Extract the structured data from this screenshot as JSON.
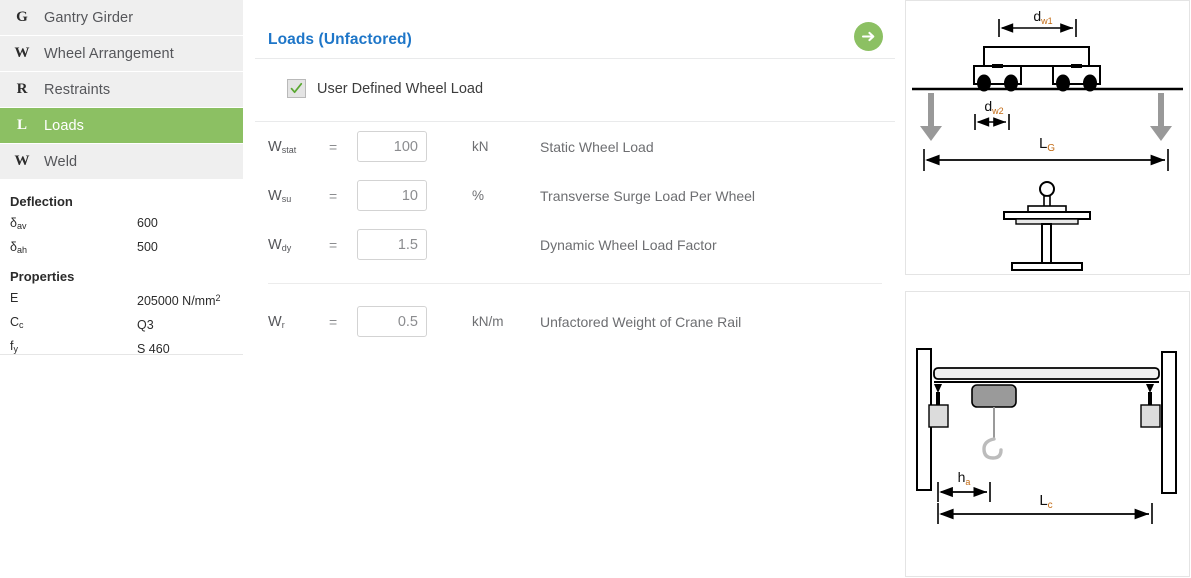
{
  "sidebar": {
    "items": [
      {
        "letter": "G",
        "label": "Gantry Girder",
        "active": false
      },
      {
        "letter": "W",
        "label": "Wheel Arrangement",
        "active": false
      },
      {
        "letter": "R",
        "label": "Restraints",
        "active": false
      },
      {
        "letter": "L",
        "label": "Loads",
        "active": true
      },
      {
        "letter": "W",
        "label": "Weld",
        "active": false
      }
    ],
    "deflection": {
      "heading": "Deflection",
      "rows": [
        {
          "key_base": "δ",
          "key_sub": "av",
          "value": "600"
        },
        {
          "key_base": "δ",
          "key_sub": "ah",
          "value": "500"
        }
      ]
    },
    "properties": {
      "heading": "Properties",
      "rows": [
        {
          "key_base": "E",
          "key_sub": "",
          "value": "205000 N/mm",
          "value_sup": "2"
        },
        {
          "key_base": "C",
          "key_sub": "c",
          "value": "Q3",
          "value_sup": ""
        },
        {
          "key_base": "f",
          "key_sub": "y",
          "value": "S 460",
          "value_sup": ""
        }
      ]
    }
  },
  "main": {
    "title": "Loads (Unfactored)",
    "next_button_icon": "arrow-right-icon",
    "checkbox": {
      "label": "User Defined Wheel Load",
      "checked": true
    },
    "fields": [
      {
        "sym_base": "W",
        "sym_sub": "stat",
        "eq": "=",
        "value": "100",
        "unit": "kN",
        "desc": "Static Wheel Load"
      },
      {
        "sym_base": "W",
        "sym_sub": "su",
        "eq": "=",
        "value": "10",
        "unit": "%",
        "desc": "Transverse Surge Load Per Wheel"
      },
      {
        "sym_base": "W",
        "sym_sub": "dy",
        "eq": "=",
        "value": "1.5",
        "unit": "",
        "desc": "Dynamic Wheel Load Factor"
      },
      {
        "sym_base": "W",
        "sym_sub": "r",
        "eq": "=",
        "value": "0.5",
        "unit": "kN/m",
        "desc": "Unfactored Weight of Crane Rail"
      }
    ]
  },
  "figures": {
    "top": {
      "name": "gantry-girder-elevation-diagram",
      "labels": {
        "dw1_base": "d",
        "dw1_sub": "w1",
        "dw2_base": "d",
        "dw2_sub": "w2",
        "lg_base": "L",
        "lg_sub": "G"
      }
    },
    "bottom": {
      "name": "crane-span-diagram",
      "labels": {
        "ha_base": "h",
        "ha_sub": "a",
        "lc_base": "L",
        "lc_sub": "c"
      }
    }
  },
  "colors": {
    "accent_green": "#8cc063",
    "title_blue": "#1e76c8",
    "sidebar_item_bg": "#efefef"
  }
}
